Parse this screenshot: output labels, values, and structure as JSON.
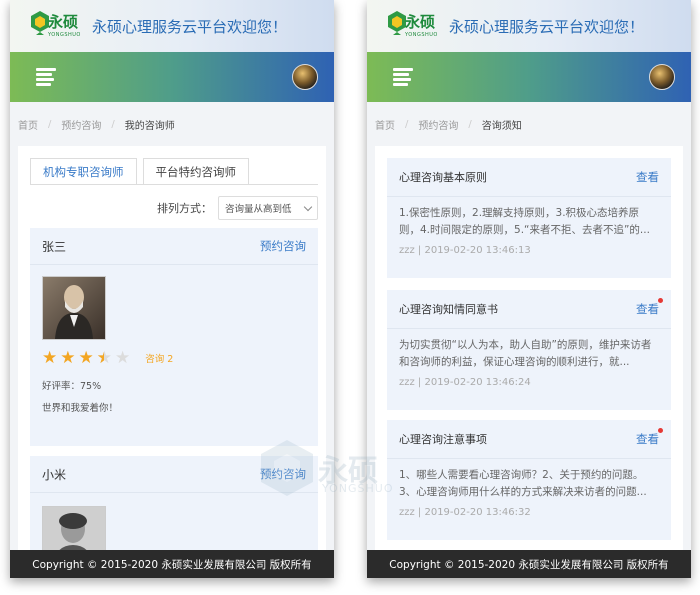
{
  "header": {
    "logo_text": "永硕",
    "logo_sub": "YONGSHUO",
    "welcome": "永硕心理服务云平台欢迎您！"
  },
  "left": {
    "breadcrumb": [
      "首页",
      "预约咨询",
      "我的咨询师"
    ],
    "tabs": [
      {
        "label": "机构专职咨询师",
        "active": true
      },
      {
        "label": "平台特约咨询师",
        "active": false
      }
    ],
    "sort_label": "排列方式：",
    "sort_value": "咨询量从高到低",
    "counselors": [
      {
        "name": "张三",
        "book_label": "预约咨询",
        "rating": 3.5,
        "consult_count": "咨询 2",
        "good_rate": "好评率：75%",
        "motto": "世界和我爱着你！"
      },
      {
        "name": "小米",
        "book_label": "预约咨询"
      }
    ]
  },
  "right": {
    "breadcrumb": [
      "首页",
      "预约咨询",
      "咨询须知"
    ],
    "notices": [
      {
        "title": "心理咨询基本原则",
        "view_label": "查看",
        "unread": false,
        "body": "1.保密性原则，2.理解支持原则，3.积极心态培养原则，4.时间限定的原则，5.“来者不拒、去者不追”的...",
        "meta": "zzz | 2019-02-20 13:46:13"
      },
      {
        "title": "心理咨询知情同意书",
        "view_label": "查看",
        "unread": true,
        "body": "为切实贯彻“以人为本，助人自助”的原则，维护来访者和咨询师的利益，保证心理咨询的顺利进行，就...",
        "meta": "zzz | 2019-02-20 13:46:24"
      },
      {
        "title": "心理咨询注意事项",
        "view_label": "查看",
        "unread": true,
        "body": "1、哪些人需要看心理咨询师？2、关于预约的问题。3、心理咨询师用什么样的方式来解决来访者的问题...",
        "meta": "zzz | 2019-02-20 13:46:32"
      }
    ]
  },
  "footer": {
    "copyright": "Copyright © 2015-2020 永硕实业发展有限公司 版权所有"
  },
  "watermark": {
    "text": "永硕",
    "sub": "YONGSHUO"
  },
  "colors": {
    "accent": "#3a7bc8",
    "star": "#f3a623",
    "footer_bg": "#2b2b2b",
    "badge": "#e53935"
  }
}
